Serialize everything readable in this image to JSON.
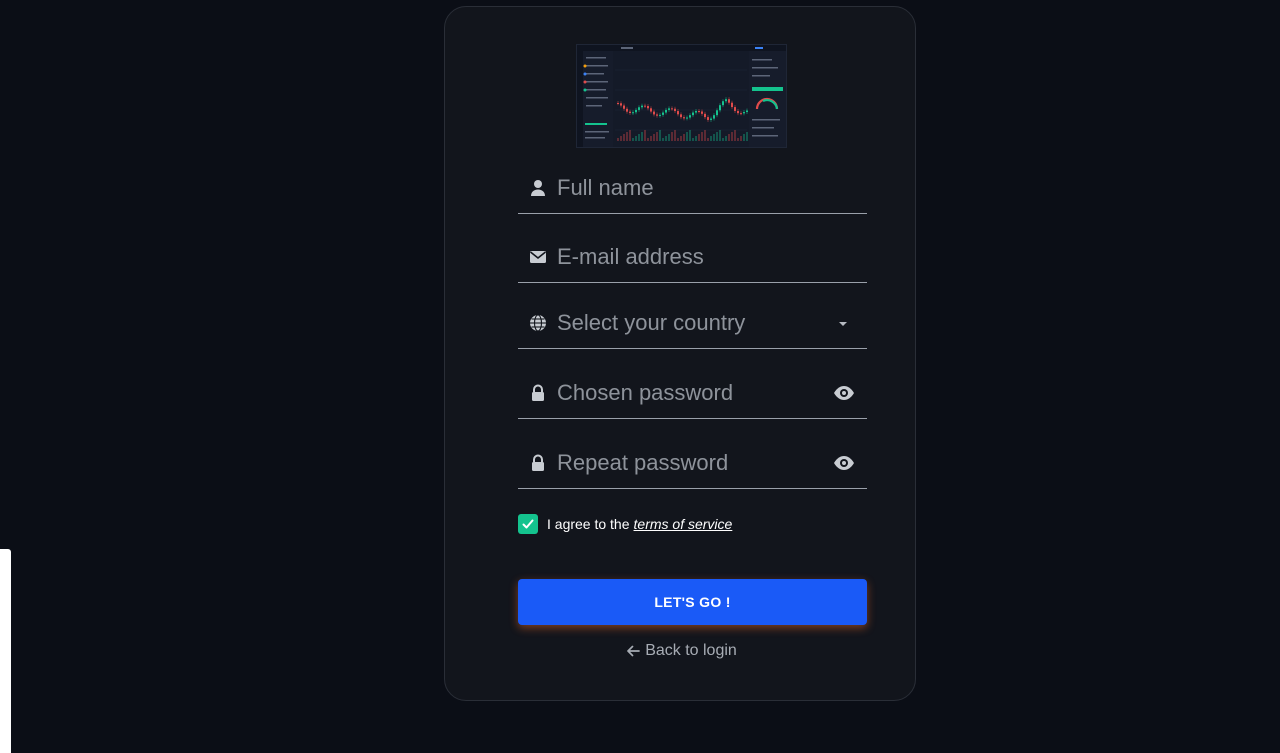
{
  "preview": {
    "alt": "trading platform preview",
    "accent_up": "#14c38e",
    "accent_down": "#e04b4b"
  },
  "form": {
    "full_name": {
      "placeholder": "Full name",
      "icon": "user-icon"
    },
    "email": {
      "placeholder": "E-mail address",
      "icon": "envelope-icon"
    },
    "country": {
      "placeholder": "Select your country",
      "icon": "globe-icon"
    },
    "password": {
      "placeholder": "Chosen password",
      "icon": "lock-icon"
    },
    "repeat_password": {
      "placeholder": "Repeat password",
      "icon": "lock-icon"
    },
    "agree": {
      "checked": true,
      "text": "I agree to the",
      "link": "terms of service"
    },
    "submit_label": "LET'S GO !",
    "back_label": "Back to login"
  },
  "colors": {
    "background": "#0b0e16",
    "card": "#12151c",
    "primary": "#1a5af7",
    "check": "#14c38e"
  }
}
